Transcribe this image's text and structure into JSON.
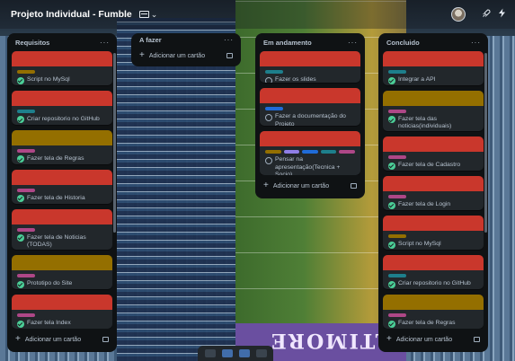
{
  "topbar": {
    "board_title": "Projeto Individual - Fumble",
    "view_icon": "table-icon",
    "view_chevron": "⌄",
    "icons": [
      "rocket-icon",
      "lightning-icon"
    ]
  },
  "background": {
    "endzone_text": "LTIMORE"
  },
  "colors": {
    "list_bg": "#0f1214",
    "card_bg": "#22272b",
    "cover_red": "#c9372c",
    "cover_yellow": "#946f00",
    "label_yellow": "#946f00",
    "label_teal": "#1d7f8c",
    "label_pink": "#ae4787",
    "label_blue": "#1f6bd8",
    "label_purple": "#8f7ee7",
    "check_green": "#4bce97"
  },
  "add_card_label": "Adicionar um cartão",
  "lists": [
    {
      "title": "Requisitos",
      "cards": [
        {
          "cover": "#c9372c",
          "labels": [
            "#946f00"
          ],
          "done": true,
          "title": "Script no MySql"
        },
        {
          "cover": "#c9372c",
          "labels": [
            "#1d7f8c"
          ],
          "done": true,
          "title": "Criar repositorio no GitHub"
        },
        {
          "cover": "#946f00",
          "labels": [
            "#ae4787"
          ],
          "done": true,
          "title": "Fazer tela de Regras"
        },
        {
          "cover": "#c9372c",
          "labels": [
            "#ae4787"
          ],
          "done": true,
          "title": "Fazer tela de Historia"
        },
        {
          "cover": "#c9372c",
          "labels": [
            "#ae4787"
          ],
          "done": true,
          "title": "Fazer tela de Noticias (TODAS)"
        },
        {
          "cover": "#946f00",
          "labels": [
            "#ae4787"
          ],
          "done": true,
          "title": "Prototipo do Site"
        },
        {
          "cover": "#c9372c",
          "labels": [
            "#ae4787"
          ],
          "done": true,
          "title": "Fazer tela Index"
        }
      ]
    },
    {
      "title": "A fazer",
      "cards": []
    },
    {
      "title": "Em andamento",
      "cards": [
        {
          "cover": "#c9372c",
          "labels": [
            "#1d7f8c"
          ],
          "done": false,
          "title": "Fazer os slides"
        },
        {
          "cover": "#c9372c",
          "labels": [
            "#1f6bd8"
          ],
          "done": false,
          "title": "Fazer a documentação do Projeto"
        },
        {
          "cover": "#c9372c",
          "labels": [
            "#946f00",
            "#8f7ee7",
            "#1f6bd8",
            "#1d7f8c",
            "#ae4787"
          ],
          "done": false,
          "title": "Pensar na apresentação(Tecnica + Socio)"
        }
      ]
    },
    {
      "title": "Concluido",
      "cards": [
        {
          "cover": "#c9372c",
          "labels": [
            "#1d7f8c"
          ],
          "done": true,
          "title": "Integrar a API"
        },
        {
          "cover": "#946f00",
          "labels": [
            "#ae4787"
          ],
          "done": true,
          "title": "Fazer tela das noticias(individuais)"
        },
        {
          "cover": "#c9372c",
          "labels": [
            "#ae4787"
          ],
          "done": true,
          "title": "Fazer tela de Cadastro"
        },
        {
          "cover": "#c9372c",
          "labels": [
            "#ae4787"
          ],
          "done": true,
          "title": "Fazer tela de Login"
        },
        {
          "cover": "#c9372c",
          "labels": [
            "#946f00"
          ],
          "done": true,
          "title": "Script no MySql"
        },
        {
          "cover": "#c9372c",
          "labels": [
            "#1d7f8c"
          ],
          "done": true,
          "title": "Criar repositorio no GitHub"
        },
        {
          "cover": "#946f00",
          "labels": [
            "#ae4787"
          ],
          "done": true,
          "title": "Fazer tela de Regras"
        }
      ]
    }
  ]
}
